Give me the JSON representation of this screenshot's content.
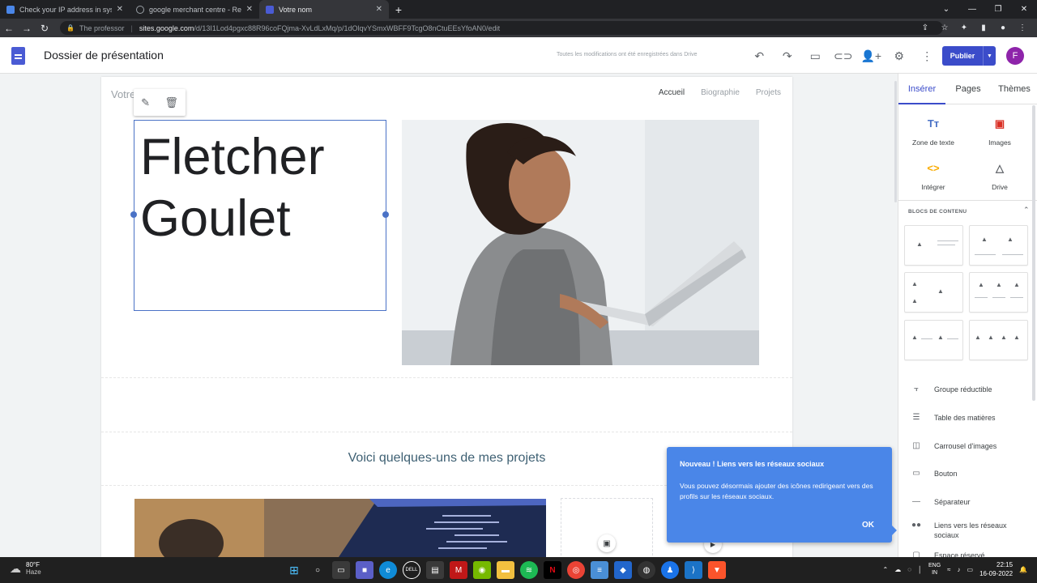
{
  "browser": {
    "tabs": [
      {
        "title": "Check your IP address in system",
        "color": "#4a86e8",
        "active": false
      },
      {
        "title": "google merchant centre - Recher",
        "color": "#9aa0a6",
        "active": false
      },
      {
        "title": "Votre nom",
        "color": "#4a5bd4",
        "active": true
      }
    ],
    "new_tab": "+",
    "profile_label": "The professor",
    "url_host": "sites.google.com",
    "url_path": "/d/13I1Lod4pgxc88R96coFQjma-XvLdLxMq/p/1dOlqvYSmxWBFF9TcgO8nCtuEEsYfoAN0/edit"
  },
  "header": {
    "doc_title": "Dossier de présentation",
    "saved_status": "Toutes les modifications ont été enregistrées dans Drive",
    "publish_label": "Publier",
    "avatar_letter": "F"
  },
  "site": {
    "name": "Votre",
    "nav": [
      "Accueil",
      "Biographie",
      "Projets"
    ],
    "hero_title_line1": "Fletcher",
    "hero_title_line2": "Goulet",
    "projects_heading": "Voici quelques-uns de mes projets"
  },
  "popup": {
    "title": "Nouveau ! Liens vers les réseaux sociaux",
    "body": "Vous pouvez désormais ajouter des icônes redirigeant vers des profils sur les réseaux sociaux.",
    "ok": "OK"
  },
  "panel": {
    "tabs": [
      "Insérer",
      "Pages",
      "Thèmes"
    ],
    "insert_items": [
      {
        "label": "Zone de texte",
        "icon": "text-box-icon",
        "glyph": "Tт",
        "color": "#4a72c6"
      },
      {
        "label": "Images",
        "icon": "image-icon",
        "glyph": "▣",
        "color": "#d93025"
      },
      {
        "label": "Intégrer",
        "icon": "embed-icon",
        "glyph": "<>",
        "color": "#f9ab00"
      },
      {
        "label": "Drive",
        "icon": "drive-icon",
        "glyph": "△",
        "color": "#5f6368"
      }
    ],
    "blocks_label": "BLOCS DE CONTENU",
    "components": [
      {
        "label": "Groupe réductible",
        "icon": "collapsible-group-icon",
        "glyph": "⫟"
      },
      {
        "label": "Table des matières",
        "icon": "table-of-contents-icon",
        "glyph": "☰"
      },
      {
        "label": "Carrousel d'images",
        "icon": "image-carousel-icon",
        "glyph": "◫"
      },
      {
        "label": "Bouton",
        "icon": "button-icon",
        "glyph": "▭"
      },
      {
        "label": "Séparateur",
        "icon": "divider-icon",
        "glyph": "—"
      },
      {
        "label": "Liens vers les réseaux sociaux",
        "icon": "social-links-icon",
        "glyph": "👥"
      },
      {
        "label": "Espace réservé",
        "icon": "placeholder-icon",
        "glyph": "▢"
      }
    ]
  },
  "taskbar": {
    "temp": "80°F",
    "weather": "Haze",
    "lang_top": "ENG",
    "lang_bottom": "IN",
    "time": "22:15",
    "date": "16-09-2022"
  }
}
